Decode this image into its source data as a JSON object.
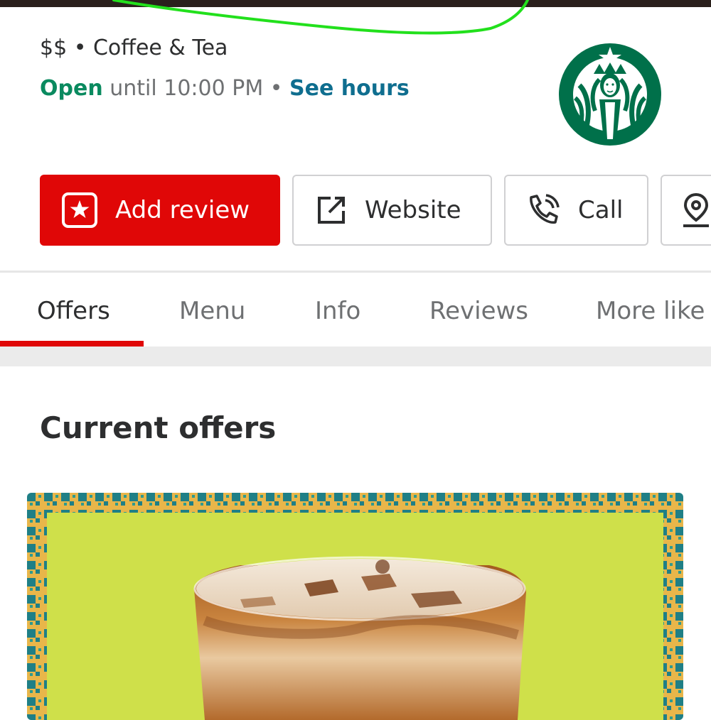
{
  "business": {
    "price_range": "$$",
    "separator": "•",
    "category": "Coffee & Tea",
    "open_status": "Open",
    "hours_text": "until 10:00 PM",
    "see_hours": "See hours"
  },
  "logo": {
    "icon": "starbucks-siren-logo",
    "color": "#00704a"
  },
  "actions": [
    {
      "label": "Add review",
      "icon": "star-in-square-icon"
    },
    {
      "label": "Website",
      "icon": "external-link-icon"
    },
    {
      "label": "Call",
      "icon": "phone-icon"
    },
    {
      "label": "",
      "icon": "map-pin-directions-icon"
    }
  ],
  "tabs": [
    {
      "label": "Offers",
      "active": true
    },
    {
      "label": "Menu",
      "active": false
    },
    {
      "label": "Info",
      "active": false
    },
    {
      "label": "Reviews",
      "active": false
    },
    {
      "label": "More like",
      "active": false
    }
  ],
  "offers": {
    "title": "Current offers",
    "card_image": "iced-coffee-drink-photo"
  },
  "colors": {
    "accent_red": "#e00707",
    "open_green": "#0a8a5f",
    "link_blue": "#0f6e8f",
    "annotation_green": "#22e01c",
    "offer_background": "#cfe04a"
  }
}
